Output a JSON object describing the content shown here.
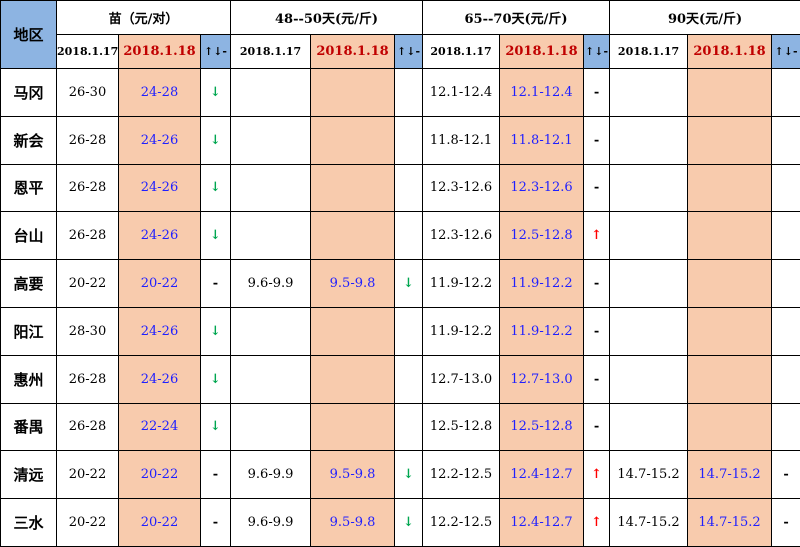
{
  "header": {
    "region_label": "地区",
    "groups": [
      {
        "title": "苗（元/对）",
        "date_old": "2018.1.17",
        "date_new": "2018.1.18",
        "trend": "↑↓-"
      },
      {
        "title": "48--50天(元/斤)",
        "date_old": "2018.1.17",
        "date_new": "2018.1.18",
        "trend": "↑↓-"
      },
      {
        "title": "65--70天(元/斤)",
        "date_old": "2018.1.17",
        "date_new": "2018.1.18",
        "trend": "↑↓-"
      },
      {
        "title": "90天(元/斤)",
        "date_old": "2018.1.17",
        "date_new": "2018.1.18",
        "trend": "↑↓-"
      }
    ]
  },
  "rows": [
    {
      "region": "马冈",
      "cells": [
        [
          "26-30",
          "24-28",
          "↓"
        ],
        [
          "",
          "",
          ""
        ],
        [
          "12.1-12.4",
          "12.1-12.4",
          "-"
        ],
        [
          "",
          "",
          ""
        ]
      ]
    },
    {
      "region": "新会",
      "cells": [
        [
          "26-28",
          "24-26",
          "↓"
        ],
        [
          "",
          "",
          ""
        ],
        [
          "11.8-12.1",
          "11.8-12.1",
          "-"
        ],
        [
          "",
          "",
          ""
        ]
      ]
    },
    {
      "region": "恩平",
      "cells": [
        [
          "26-28",
          "24-26",
          "↓"
        ],
        [
          "",
          "",
          ""
        ],
        [
          "12.3-12.6",
          "12.3-12.6",
          "-"
        ],
        [
          "",
          "",
          ""
        ]
      ]
    },
    {
      "region": "台山",
      "cells": [
        [
          "26-28",
          "24-26",
          "↓"
        ],
        [
          "",
          "",
          ""
        ],
        [
          "12.3-12.6",
          "12.5-12.8",
          "↑"
        ],
        [
          "",
          "",
          ""
        ]
      ]
    },
    {
      "region": "高要",
      "cells": [
        [
          "20-22",
          "20-22",
          "-"
        ],
        [
          "9.6-9.9",
          "9.5-9.8",
          "↓"
        ],
        [
          "11.9-12.2",
          "11.9-12.2",
          "-"
        ],
        [
          "",
          "",
          ""
        ]
      ]
    },
    {
      "region": "阳江",
      "cells": [
        [
          "28-30",
          "24-26",
          "↓"
        ],
        [
          "",
          "",
          ""
        ],
        [
          "11.9-12.2",
          "11.9-12.2",
          "-"
        ],
        [
          "",
          "",
          ""
        ]
      ]
    },
    {
      "region": "惠州",
      "cells": [
        [
          "26-28",
          "24-26",
          "↓"
        ],
        [
          "",
          "",
          ""
        ],
        [
          "12.7-13.0",
          "12.7-13.0",
          "-"
        ],
        [
          "",
          "",
          ""
        ]
      ]
    },
    {
      "region": "番禺",
      "cells": [
        [
          "26-28",
          "22-24",
          "↓"
        ],
        [
          "",
          "",
          ""
        ],
        [
          "12.5-12.8",
          "12.5-12.8",
          "-"
        ],
        [
          "",
          "",
          ""
        ]
      ]
    },
    {
      "region": "清远",
      "cells": [
        [
          "20-22",
          "20-22",
          "-"
        ],
        [
          "9.6-9.9",
          "9.5-9.8",
          "↓"
        ],
        [
          "12.2-12.5",
          "12.4-12.7",
          "↑"
        ],
        [
          "14.7-15.2",
          "14.7-15.2",
          "-"
        ]
      ]
    },
    {
      "region": "三水",
      "cells": [
        [
          "20-22",
          "20-22",
          "-"
        ],
        [
          "9.6-9.9",
          "9.5-9.8",
          "↓"
        ],
        [
          "12.2-12.5",
          "12.4-12.7",
          "↑"
        ],
        [
          "14.7-15.2",
          "14.7-15.2",
          "-"
        ]
      ]
    }
  ]
}
